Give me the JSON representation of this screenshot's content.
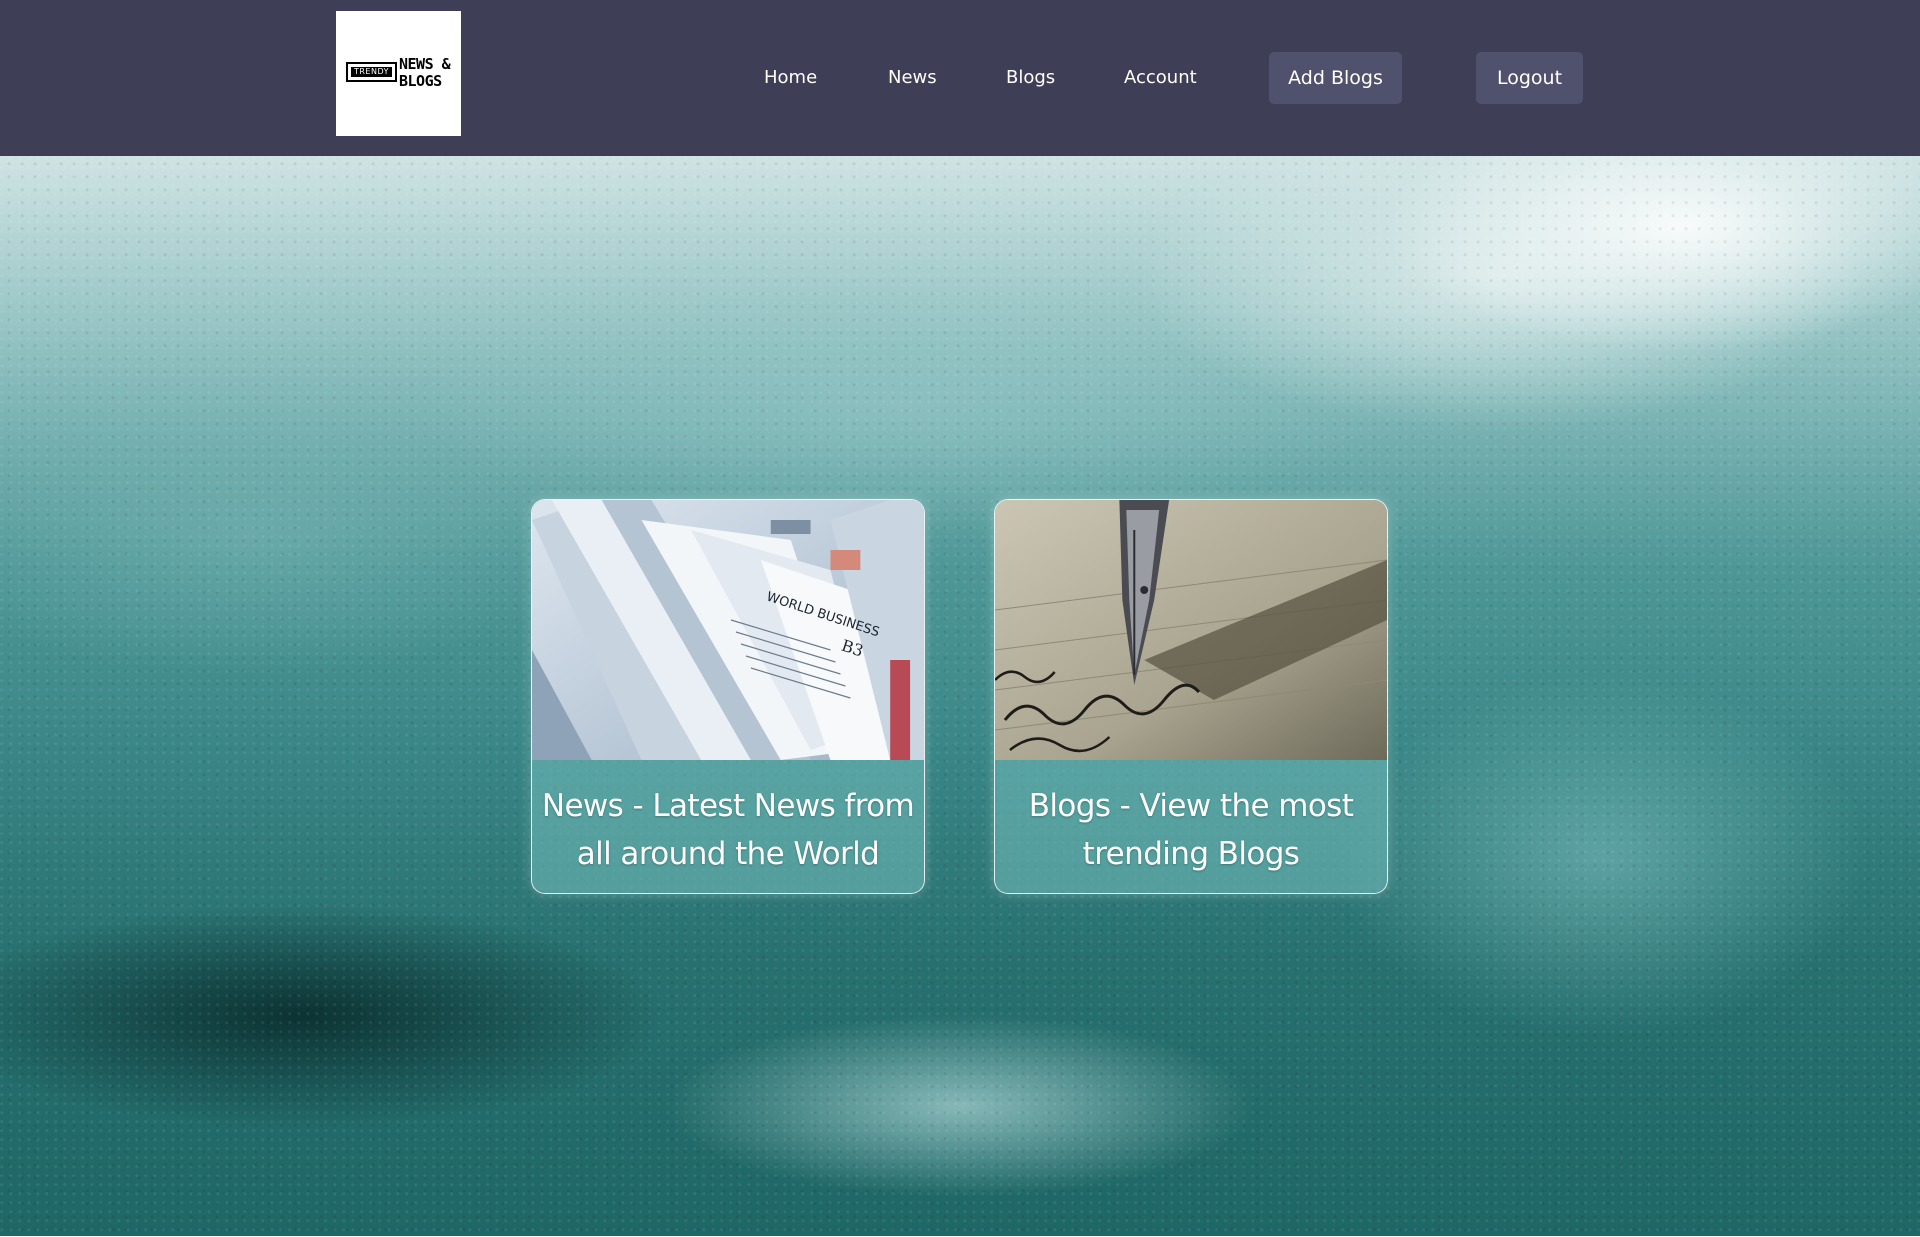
{
  "header": {
    "logo": {
      "badge": "TRENDY",
      "line1": "NEWS &",
      "line2": "BLOGS"
    },
    "nav": [
      {
        "label": "Home"
      },
      {
        "label": "News"
      },
      {
        "label": "Blogs"
      },
      {
        "label": "Account"
      }
    ],
    "add_blogs_label": "Add Blogs",
    "logout_label": "Logout"
  },
  "cards": [
    {
      "title": "News - Latest News from all around the World",
      "image_icon": "newspaper-image"
    },
    {
      "title": "Blogs - View the most trending Blogs",
      "image_icon": "fountain-pen-image"
    }
  ],
  "colors": {
    "header_bg": "#3e3f56",
    "button_bg": "#50516c",
    "text": "#ffffff"
  }
}
